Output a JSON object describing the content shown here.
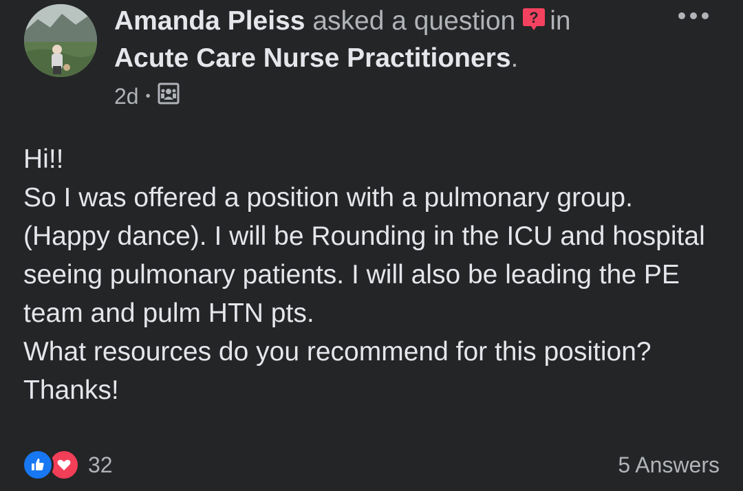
{
  "post": {
    "author": "Amanda Pleiss",
    "action": "asked a question",
    "preposition": "in",
    "group": "Acute Care Nurse Practitioners",
    "group_suffix": ".",
    "time": "2d",
    "meta_separator": "•",
    "privacy_icon": "group-members-icon",
    "body_lines": [
      "Hi!!",
      "So I was offered a position with a pulmonary group. (Happy dance). I will be Rounding in the ICU and hospital seeing pulmonary patients. I will also be leading the PE team and pulm HTN pts.",
      "What resources do you recommend for this position? Thanks!"
    ]
  },
  "footer": {
    "reaction_count": "32",
    "answers_label": "5 Answers"
  },
  "colors": {
    "background": "#242526",
    "text_primary": "#e4e6eb",
    "text_secondary": "#b0b3b8",
    "like_blue": "#1877f2",
    "love_red": "#f33e58",
    "question_badge": "#f3425f"
  }
}
